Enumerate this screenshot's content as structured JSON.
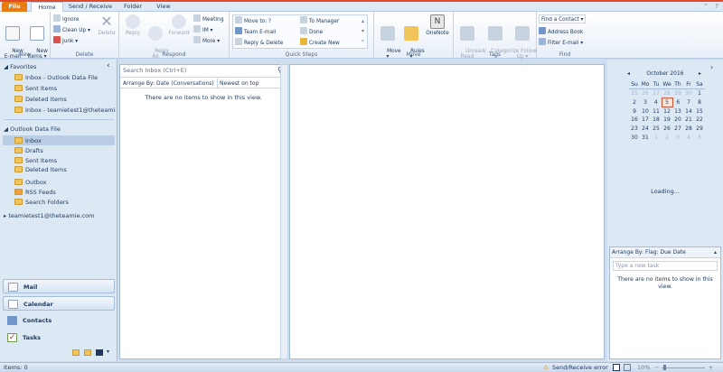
{
  "tabs": {
    "file": "File",
    "home": "Home",
    "send_receive": "Send / Receive",
    "folder": "Folder",
    "view": "View"
  },
  "ribbon": {
    "new": {
      "new_email": "New\nE-mail",
      "new_items": "New\nItems ▾",
      "group": "New"
    },
    "delete": {
      "ignore": "Ignore",
      "clean_up": "Clean Up ▾",
      "junk": "Junk ▾",
      "delete": "Delete",
      "group": "Delete"
    },
    "respond": {
      "reply": "Reply",
      "reply_all": "Reply\nAll",
      "forward": "Forward",
      "meeting": "Meeting",
      "im": "IM ▾",
      "more": "More ▾",
      "group": "Respond"
    },
    "quick_steps": {
      "move_to": "Move to: ?",
      "team_email": "Team E-mail",
      "reply_delete": "Reply & Delete",
      "to_manager": "To Manager",
      "done": "Done",
      "create_new": "Create New",
      "group": "Quick Steps"
    },
    "move": {
      "move": "Move\n▾",
      "rules": "Rules\n▾",
      "onenote": "OneNote",
      "group": "Move"
    },
    "tags": {
      "unread_read": "Unread/\nRead",
      "categorize": "Categorize\n▾",
      "follow_up": "Follow\nUp ▾",
      "group": "Tags"
    },
    "find": {
      "find_contact": "Find a Contact ▾",
      "address_book": "Address Book",
      "filter_email": "Filter E-mail ▾",
      "group": "Find"
    }
  },
  "nav": {
    "favorites_header": "Favorites",
    "favorites": [
      "Inbox - Outlook Data File",
      "Sent Items",
      "Deleted Items",
      "Inbox - teamietest1@theteamie..."
    ],
    "data_file_header": "Outlook Data File",
    "folders": [
      "Inbox",
      "Drafts",
      "Sent Items",
      "Deleted Items",
      "Outbox",
      "RSS Feeds",
      "Search Folders"
    ],
    "account": "teamietest1@theteamie.com",
    "collapse_glyph": "‹"
  },
  "workspace": {
    "mail": "Mail",
    "calendar": "Calendar",
    "contacts": "Contacts",
    "tasks": "Tasks"
  },
  "message_list": {
    "search_placeholder": "Search Inbox (Ctrl+E)",
    "arrange_by": "Arrange By: Date (Conversations)",
    "sort": "Newest on top",
    "empty": "There are no items to show in this view."
  },
  "calendar": {
    "month": "October 2016",
    "days": [
      "Su",
      "Mo",
      "Tu",
      "We",
      "Th",
      "Fr",
      "Sa"
    ],
    "weeks": [
      [
        "25",
        "26",
        "27",
        "28",
        "29",
        "30",
        "1"
      ],
      [
        "2",
        "3",
        "4",
        "5",
        "6",
        "7",
        "8"
      ],
      [
        "9",
        "10",
        "11",
        "12",
        "13",
        "14",
        "15"
      ],
      [
        "16",
        "17",
        "18",
        "19",
        "20",
        "21",
        "22"
      ],
      [
        "23",
        "24",
        "25",
        "26",
        "27",
        "28",
        "29"
      ],
      [
        "30",
        "31",
        "1",
        "2",
        "3",
        "4",
        "5"
      ]
    ],
    "today": "5",
    "loading": "Loading..."
  },
  "tasks": {
    "arrange_by": "Arrange By: Flag: Due Date",
    "placeholder": "Type a new task",
    "empty": "There are no items to show in this view."
  },
  "status": {
    "items": "Items: 0",
    "error": "Send/Receive error",
    "zoom": "10%"
  },
  "colors": {
    "accent": "#e87b11",
    "ribbon": "#e8eff8",
    "pane": "#dde8f5",
    "border": "#a5bcd8"
  }
}
